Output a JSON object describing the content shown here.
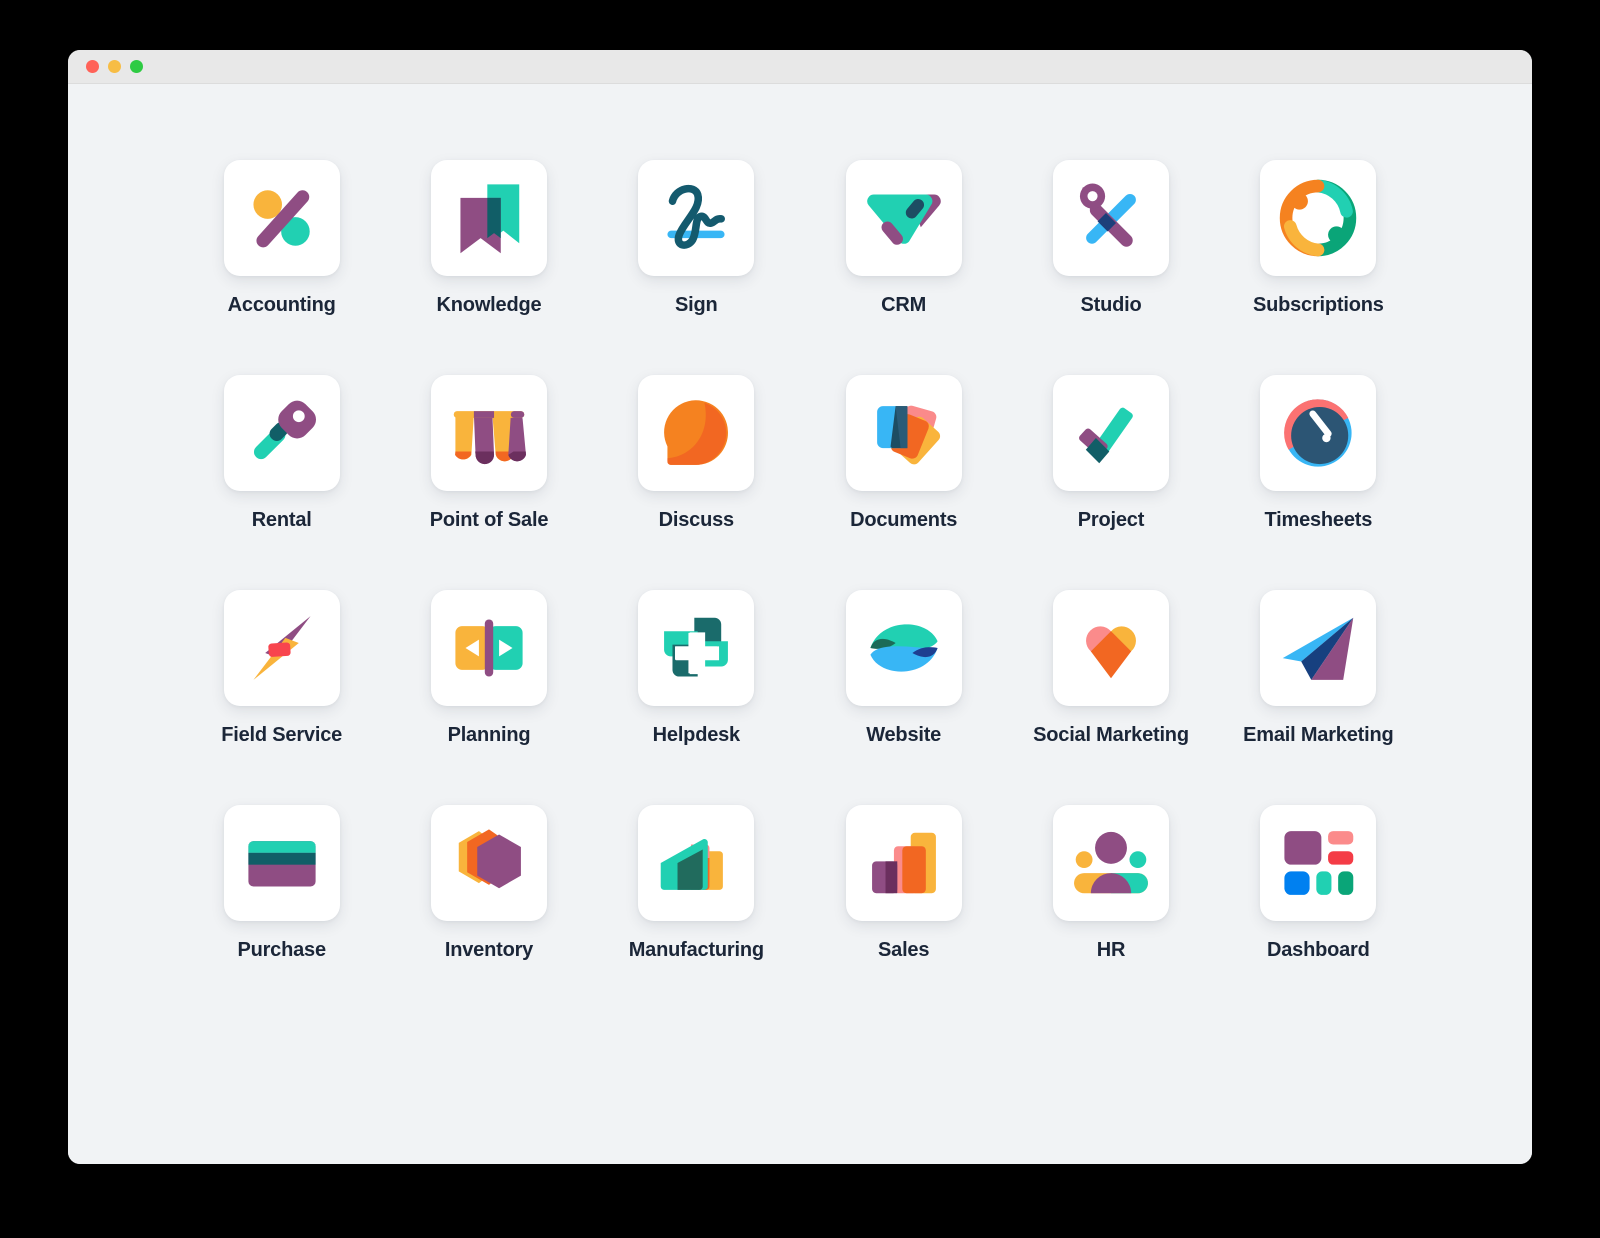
{
  "window": {
    "traffic_lights": [
      "close",
      "minimize",
      "zoom"
    ],
    "background_color": "#f1f3f5",
    "titlebar_color": "#e8e8e8"
  },
  "palette": {
    "purple": "#8f4d83",
    "purple_dark": "#6b2f5e",
    "teal": "#21d0b2",
    "teal_dark": "#1a6b6b",
    "teal_deep": "#115e67",
    "navy": "#1d4d63",
    "navy_dark": "#17406b",
    "blue": "#38b6f5",
    "blue_bright": "#0080f0",
    "orange": "#f58220",
    "orange_deep": "#f26722",
    "amber": "#f9b43c",
    "yellow": "#fbbe4a",
    "pink": "#fa8a8a",
    "red": "#f43c46",
    "green": "#0aa578",
    "label_color": "#1b2638"
  },
  "apps": [
    {
      "label": "Accounting",
      "icon": "accounting-icon"
    },
    {
      "label": "Knowledge",
      "icon": "knowledge-icon"
    },
    {
      "label": "Sign",
      "icon": "sign-icon"
    },
    {
      "label": "CRM",
      "icon": "crm-icon"
    },
    {
      "label": "Studio",
      "icon": "studio-icon"
    },
    {
      "label": "Subscriptions",
      "icon": "subscriptions-icon"
    },
    {
      "label": "Rental",
      "icon": "rental-icon"
    },
    {
      "label": "Point of Sale",
      "icon": "point-of-sale-icon"
    },
    {
      "label": "Discuss",
      "icon": "discuss-icon"
    },
    {
      "label": "Documents",
      "icon": "documents-icon"
    },
    {
      "label": "Project",
      "icon": "project-icon"
    },
    {
      "label": "Timesheets",
      "icon": "timesheets-icon"
    },
    {
      "label": "Field Service",
      "icon": "field-service-icon"
    },
    {
      "label": "Planning",
      "icon": "planning-icon"
    },
    {
      "label": "Helpdesk",
      "icon": "helpdesk-icon"
    },
    {
      "label": "Website",
      "icon": "website-icon"
    },
    {
      "label": "Social Marketing",
      "icon": "social-marketing-icon"
    },
    {
      "label": "Email Marketing",
      "icon": "email-marketing-icon"
    },
    {
      "label": "Purchase",
      "icon": "purchase-icon"
    },
    {
      "label": "Inventory",
      "icon": "inventory-icon"
    },
    {
      "label": "Manufacturing",
      "icon": "manufacturing-icon"
    },
    {
      "label": "Sales",
      "icon": "sales-icon"
    },
    {
      "label": "HR",
      "icon": "hr-icon"
    },
    {
      "label": "Dashboard",
      "icon": "dashboard-icon"
    }
  ]
}
